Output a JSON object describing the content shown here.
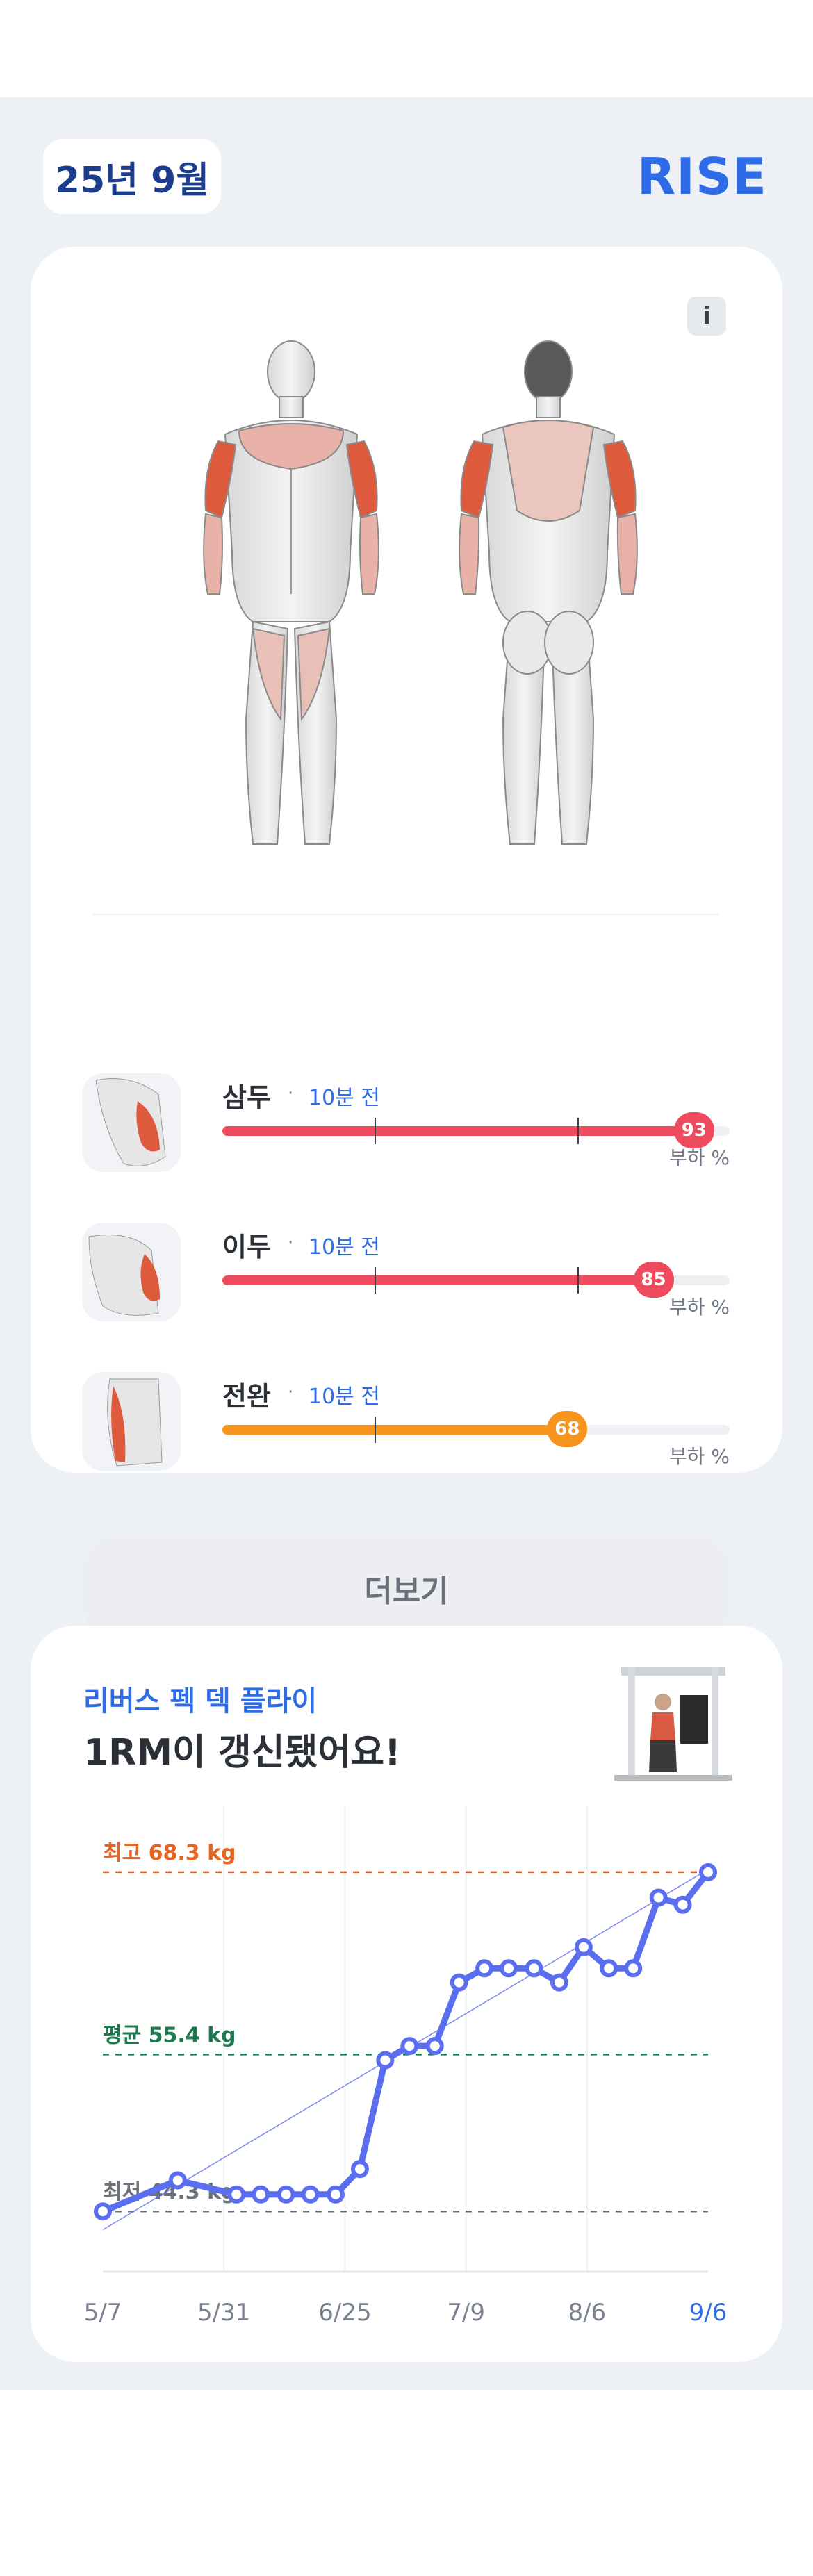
{
  "header": {
    "month": "25년 9월",
    "brand": "RISE"
  },
  "card": {
    "info_label": "i",
    "muscles": [
      {
        "name": "삼두",
        "dot": "·",
        "time": "10분 전",
        "value": 93,
        "percent": 0.93,
        "color": "#ef4b5e",
        "load_label": "부하 %"
      },
      {
        "name": "이두",
        "dot": "·",
        "time": "10분 전",
        "value": 85,
        "percent": 0.85,
        "color": "#ef4b5e",
        "load_label": "부하 %"
      },
      {
        "name": "전완",
        "dot": "·",
        "time": "10분 전",
        "value": 68,
        "percent": 0.68,
        "color": "#f7941d",
        "load_label": "부하 %"
      }
    ],
    "more_label": "더보기"
  },
  "progress": {
    "exercise_name": "리버스 펙 덱 플라이",
    "headline": "1RM이 갱신됐어요!"
  },
  "chart_data": {
    "type": "line",
    "x_labels": [
      "5/7",
      "5/31",
      "6/25",
      "7/9",
      "8/6",
      "9/6"
    ],
    "values": [
      44.3,
      46.5,
      45.5,
      45.5,
      45.5,
      45.5,
      45.5,
      47.3,
      55.0,
      56.0,
      56.0,
      60.5,
      61.5,
      61.5,
      61.5,
      60.5,
      63.0,
      61.5,
      61.5,
      66.5,
      66.0,
      68.3
    ],
    "x_positions": [
      0,
      7.4,
      13.2,
      15.6,
      18.1,
      20.5,
      23.0,
      25.4,
      27.9,
      30.3,
      32.8,
      35.2,
      37.7,
      40.1,
      42.6,
      45.1,
      47.5,
      50.0,
      52.4,
      54.9,
      57.3,
      59.8
    ],
    "y_range": [
      42.0,
      71.0
    ],
    "ref_lines": [
      {
        "label": "최고 68.3 kg",
        "value": 68.3,
        "color": "#e8631e"
      },
      {
        "label": "평균 55.4 kg",
        "value": 55.4,
        "color": "#1e7a4e"
      },
      {
        "label": "최저 44.3 kg",
        "value": 44.3,
        "color": "#6b717a"
      }
    ],
    "trend": [
      [
        0,
        43.0
      ],
      [
        59.8,
        68.5
      ]
    ],
    "series_color": "#5b6ef0",
    "highlight_label_color": "#2e6be6"
  }
}
